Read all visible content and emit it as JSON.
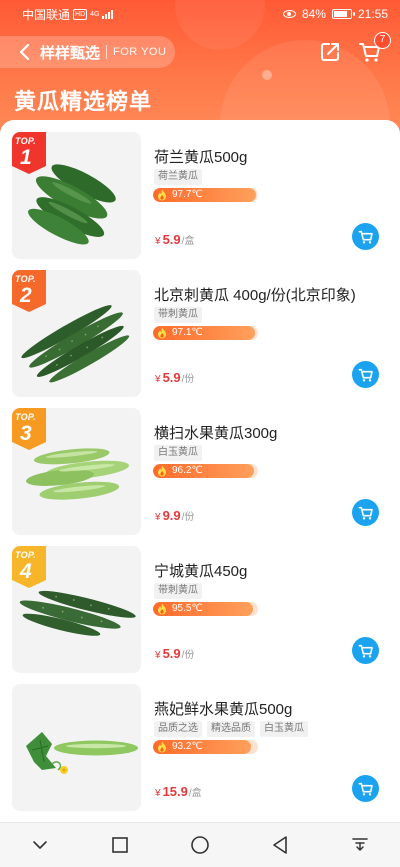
{
  "status_bar": {
    "carrier": "中国联通",
    "hd": "HD",
    "network": "4G",
    "battery": "84%",
    "battery_level": 0.84,
    "time": "21:55"
  },
  "nav": {
    "title": "样样甄选",
    "subtitle": "FOR YOU",
    "cart_badge": "7"
  },
  "page_title": "黄瓜精选榜单",
  "rank_label": "TOP.",
  "currency": "¥",
  "items": [
    {
      "rank": "1",
      "title": "荷兰黄瓜500g",
      "tags": [
        "荷兰黄瓜"
      ],
      "heat": "97.7℃",
      "heat_level": 0.977,
      "price": "5.9",
      "unit": "/盒",
      "rank_color": "#f0352d"
    },
    {
      "rank": "2",
      "title": "北京刺黄瓜 400g/份(北京印象)",
      "tags": [
        "带刺黄瓜"
      ],
      "heat": "97.1℃",
      "heat_level": 0.971,
      "price": "5.9",
      "unit": "/份",
      "rank_color": "#f5692a"
    },
    {
      "rank": "3",
      "title": "横扫水果黄瓜300g",
      "tags": [
        "白玉黄瓜"
      ],
      "heat": "96.2℃",
      "heat_level": 0.962,
      "price": "9.9",
      "unit": "/份",
      "rank_color": "#f79a22"
    },
    {
      "rank": "4",
      "title": "宁城黄瓜450g",
      "tags": [
        "带刺黄瓜"
      ],
      "heat": "95.5℃",
      "heat_level": 0.955,
      "price": "5.9",
      "unit": "/份",
      "rank_color": "#f7b52a"
    },
    {
      "rank": "",
      "title": "燕妃鲜水果黄瓜500g",
      "tags": [
        "品质之选",
        "精选品质",
        "白玉黄瓜"
      ],
      "heat": "93.2℃",
      "heat_level": 0.932,
      "price": "15.9",
      "unit": "/盒",
      "rank_color": ""
    }
  ],
  "icons": {
    "back": "chevron-left-icon",
    "share": "share-icon",
    "cart": "cart-icon",
    "flame": "flame-icon",
    "sys_back": "triangle-back-icon",
    "sys_home": "circle-home-icon",
    "sys_recent": "square-recent-icon",
    "sys_collapse": "chevron-down-icon",
    "sys_notify": "pull-down-icon"
  },
  "colors": {
    "header": "#ff5a36",
    "price": "#e4393c",
    "cart_button": "#1ba3f0",
    "heat": "#ff6a2a"
  }
}
